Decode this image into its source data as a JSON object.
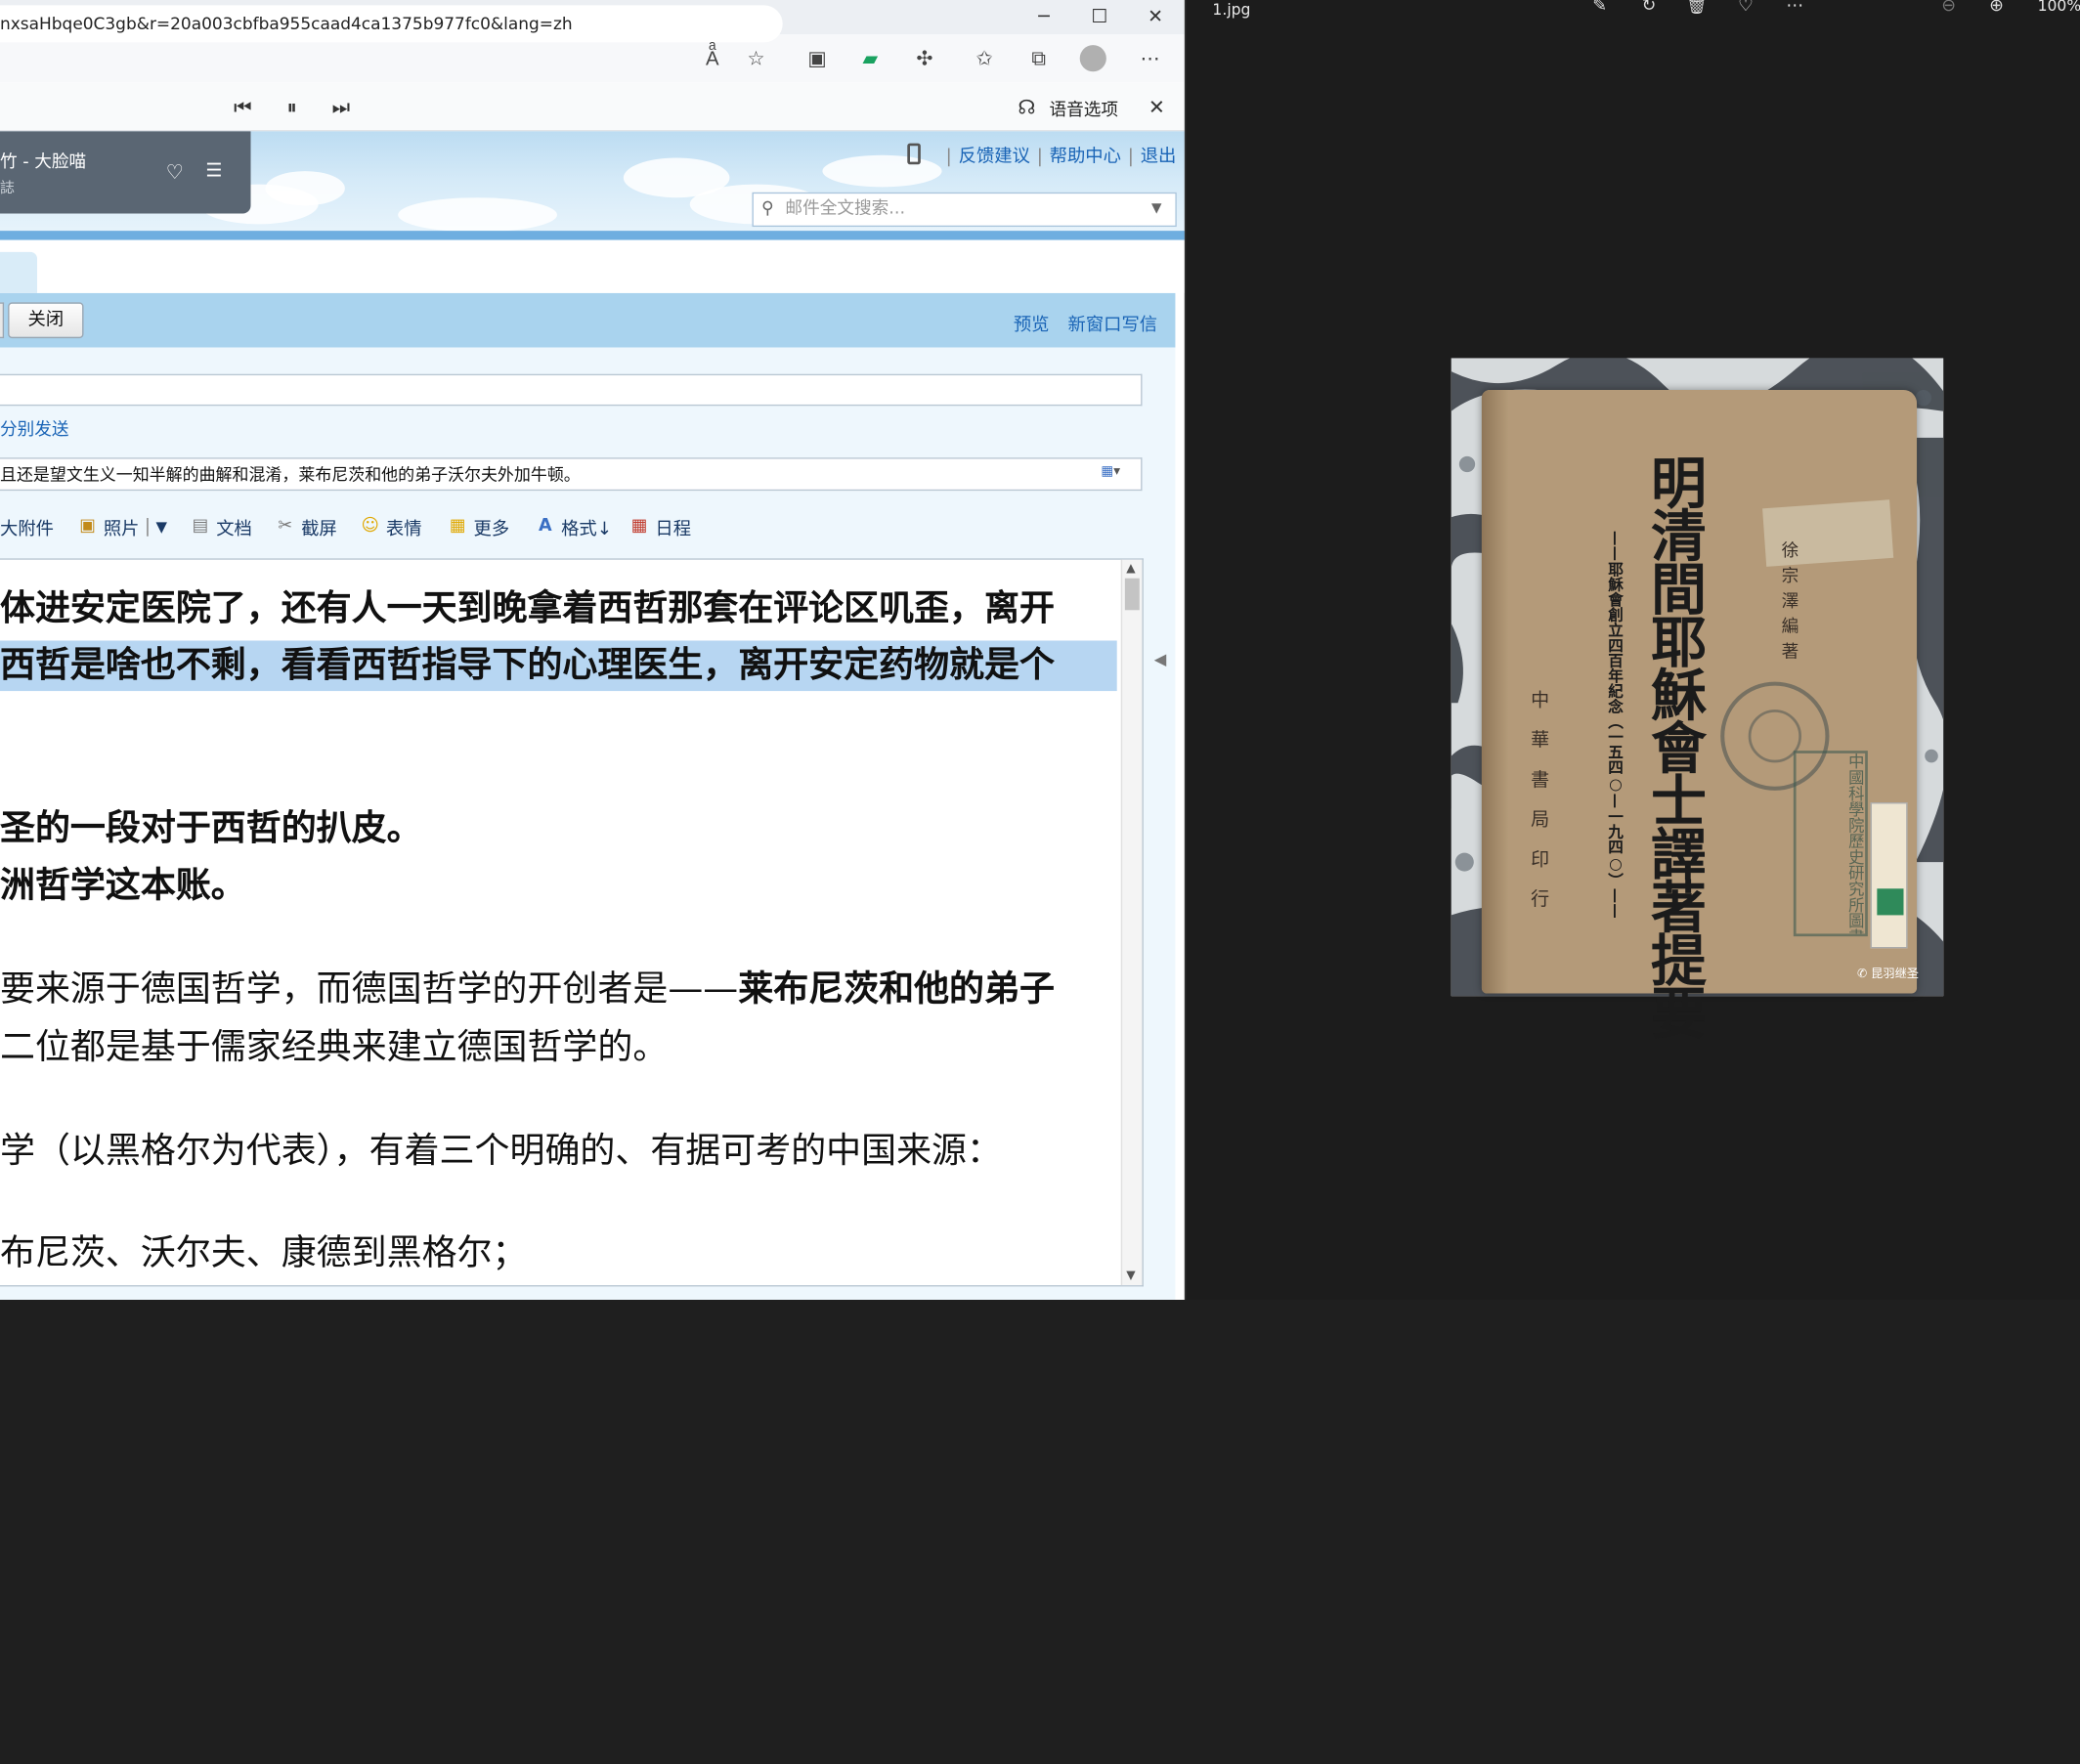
{
  "browser": {
    "url": "nxsaHbqe0C3gb&r=20a003cbfba955caad4ca1375b977fc0&lang=zh",
    "read_aloud": {
      "voice_options": "语音选项"
    }
  },
  "mail": {
    "music": {
      "title": "竹 - 大脸喵",
      "subtitle": "誌"
    },
    "top_links": [
      "反馈建议",
      "帮助中心",
      "退出"
    ],
    "search_placeholder": "邮件全文搜索...",
    "toolbar": {
      "close": "关闭",
      "preview": "预览",
      "new_window": "新窗口写信"
    },
    "send_separately": "分别发送",
    "subject": "且还是望文生义一知半解的曲解和混淆，莱布尼茨和他的弟子沃尔夫外加牛顿。",
    "attach_bar": {
      "big_attachment": "大附件",
      "photo": "照片",
      "document": "文档",
      "screenshot": "截屏",
      "emoji": "表情",
      "more": "更多",
      "format": "格式↓",
      "schedule": "日程"
    },
    "body": {
      "l1": "体进安定医院了，还有人一天到晚拿着西哲那套在评论区叽歪，离开",
      "l2": "西哲是啥也不剩，看看西哲指导下的心理医生，离开安定药物就是个",
      "l3": "圣的一段对于西哲的扒皮。",
      "l4": "洲哲学这本账。",
      "l5a": "要来源于德国哲学，而德国哲学的开创者是——",
      "l5b": "莱布尼茨和他的弟子",
      "l6": "二位都是基于儒家经典来建立德国哲学的。",
      "l7": "学（以黑格尔为代表），有着三个明确的、有据可考的中国来源：",
      "l8": "布尼茨、沃尔夫、康德到黑格尔；"
    }
  },
  "viewer": {
    "filename": "1.jpg",
    "zoom": "100%",
    "photo": {
      "title": "明清間耶穌會士譯著提要",
      "subtitle": "——耶穌會創立四百年紀念（一五四○—一九四○）——",
      "author": "徐宗澤編著",
      "publisher": "中華書局印行",
      "stamp_text": "中國科學院歷史研究所圖書館藏書",
      "watermark": "昆羽继圣"
    }
  },
  "colors": {
    "link": "#1a64b6",
    "highlight": "#b7d6f2",
    "compose_bar": "#a9d3ee",
    "viewer_bg": "#1c1c1c"
  }
}
